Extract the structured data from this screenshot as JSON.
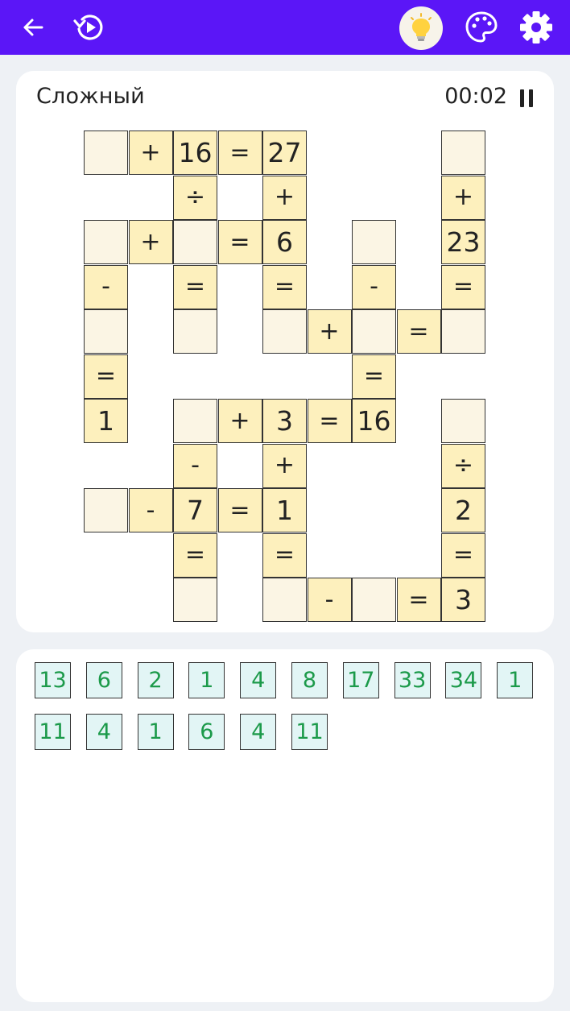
{
  "toolbar": {
    "back_icon": "arrow-left-icon",
    "restart_icon": "restart-play-icon",
    "hint_icon": "lightbulb-icon",
    "theme_icon": "palette-icon",
    "settings_icon": "gear-icon"
  },
  "colors": {
    "topbar": "#5b16f7",
    "cell_fill": "#fdf0bd",
    "empty_cell_fill": "#fbf5e4",
    "tile_fill": "#e2f5f5",
    "tile_text": "#1c9a4a"
  },
  "header": {
    "difficulty": "Сложный",
    "timer": "00:02",
    "pause_icon": "pause-icon"
  },
  "board": {
    "rows": [
      [
        "",
        "+",
        "16",
        "=",
        "27",
        null,
        null,
        null,
        ""
      ],
      [
        null,
        null,
        "÷",
        null,
        "+",
        null,
        null,
        null,
        "+"
      ],
      [
        "",
        "+",
        "",
        "=",
        "6",
        null,
        "",
        null,
        "23"
      ],
      [
        "-",
        null,
        "=",
        null,
        "=",
        null,
        "-",
        null,
        "="
      ],
      [
        "",
        null,
        "",
        null,
        "",
        "+",
        "",
        "=",
        ""
      ],
      [
        "=",
        null,
        null,
        null,
        null,
        null,
        "=",
        null,
        null
      ],
      [
        "1",
        null,
        "",
        "+",
        "3",
        "=",
        "16",
        null,
        ""
      ],
      [
        null,
        null,
        "-",
        null,
        "+",
        null,
        null,
        null,
        "÷"
      ],
      [
        "",
        "-",
        "7",
        "=",
        "1",
        null,
        null,
        null,
        "2"
      ],
      [
        null,
        null,
        "=",
        null,
        "=",
        null,
        null,
        null,
        "="
      ],
      [
        null,
        null,
        "",
        null,
        "",
        "-",
        "",
        "=",
        "3"
      ]
    ]
  },
  "number_bank": {
    "rows": [
      [
        "13",
        "6",
        "2",
        "1",
        "4",
        "8",
        "17",
        "33",
        "34",
        "1"
      ],
      [
        "11",
        "4",
        "1",
        "6",
        "4",
        "11"
      ]
    ]
  }
}
